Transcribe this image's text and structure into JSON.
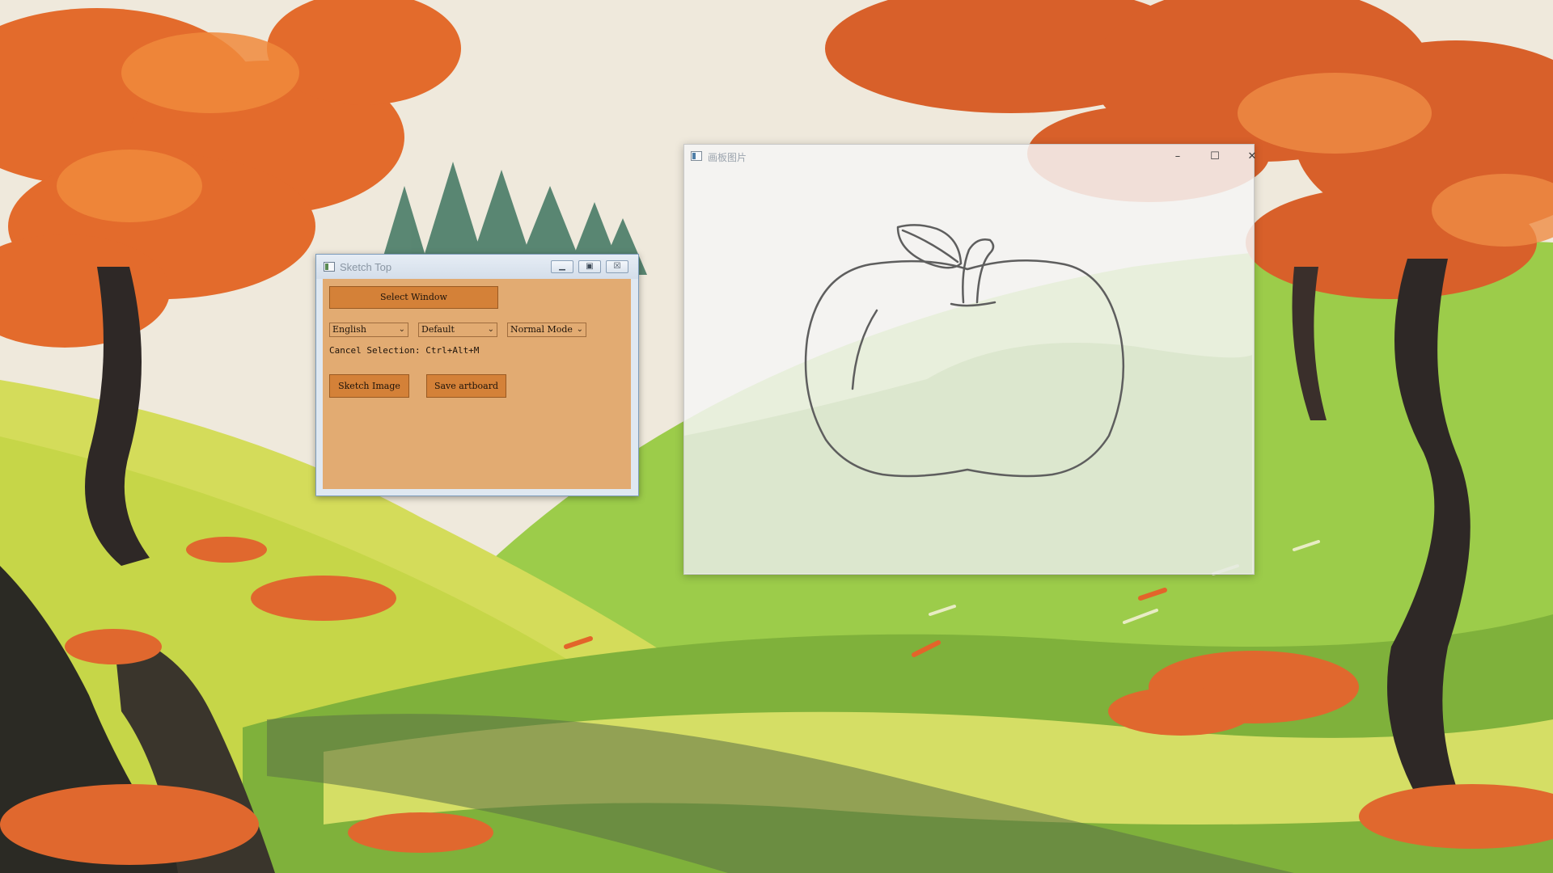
{
  "sketch_window": {
    "title": "Sketch Top",
    "minimize_icon": "minimize-icon",
    "maximize_icon": "restore-icon",
    "close_icon": "close-icon",
    "select_window_label": "Select Window",
    "language_select": {
      "value": "English"
    },
    "style_select": {
      "value": "Default"
    },
    "mode_select": {
      "value": "Normal Mode"
    },
    "cancel_hint": "Cancel Selection: Ctrl+Alt+M",
    "sketch_image_label": "Sketch Image",
    "save_artboard_label": "Save artboard",
    "colors": {
      "body": "#e2ab72",
      "button": "#d48138"
    }
  },
  "artboard_window": {
    "title": "画板图片",
    "minimize_glyph": "–",
    "maximize_glyph": "☐",
    "close_glyph": "✕",
    "content": "apple-line-drawing"
  },
  "desktop": {
    "wallpaper": "autumn-landscape"
  }
}
